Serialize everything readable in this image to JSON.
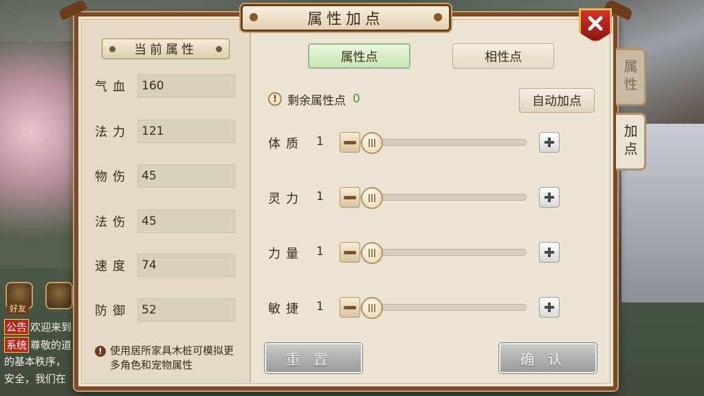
{
  "window": {
    "title": "属性加点"
  },
  "side_tabs": {
    "attributes": "属性",
    "add_points": "加点"
  },
  "left_panel": {
    "header": "当前属性",
    "stats": [
      {
        "label": "气血",
        "value": "160"
      },
      {
        "label": "法力",
        "value": "121"
      },
      {
        "label": "物伤",
        "value": "45"
      },
      {
        "label": "法伤",
        "value": "45"
      },
      {
        "label": "速度",
        "value": "74"
      },
      {
        "label": "防御",
        "value": "52"
      }
    ],
    "hint": "使用居所家具木桩可模拟更多角色和宠物属性"
  },
  "mode_buttons": {
    "attribute_points": "属性点",
    "affinity_points": "相性点"
  },
  "remaining": {
    "label": "剩余属性点",
    "value": "0"
  },
  "auto_add_label": "自动加点",
  "sliders": [
    {
      "label": "体质",
      "value": "1",
      "level": 0
    },
    {
      "label": "灵力",
      "value": "1",
      "level": 0
    },
    {
      "label": "力量",
      "value": "1",
      "level": 0
    },
    {
      "label": "敏捷",
      "value": "1",
      "level": 0
    }
  ],
  "bottom_buttons": {
    "reset": "重置",
    "confirm": "确认"
  },
  "background_hud": {
    "friends_label": "好友",
    "chat_lines": [
      {
        "tag": "公告",
        "text": "欢迎来到"
      },
      {
        "tag": "系统",
        "text": "尊敬的道"
      },
      {
        "tag": "",
        "text": "的基本秩序，"
      },
      {
        "tag": "",
        "text": "安全，我们在"
      }
    ]
  },
  "colors": {
    "panel_bg": "#ece4d3",
    "frame": "#7a4a2a",
    "close_red": "#c62820",
    "remaining_green": "#2e9d2e",
    "selected_mode": "#c6e6b4"
  },
  "icons": [
    "close-icon",
    "info-icon",
    "warning-icon",
    "minus-icon",
    "plus-icon"
  ]
}
